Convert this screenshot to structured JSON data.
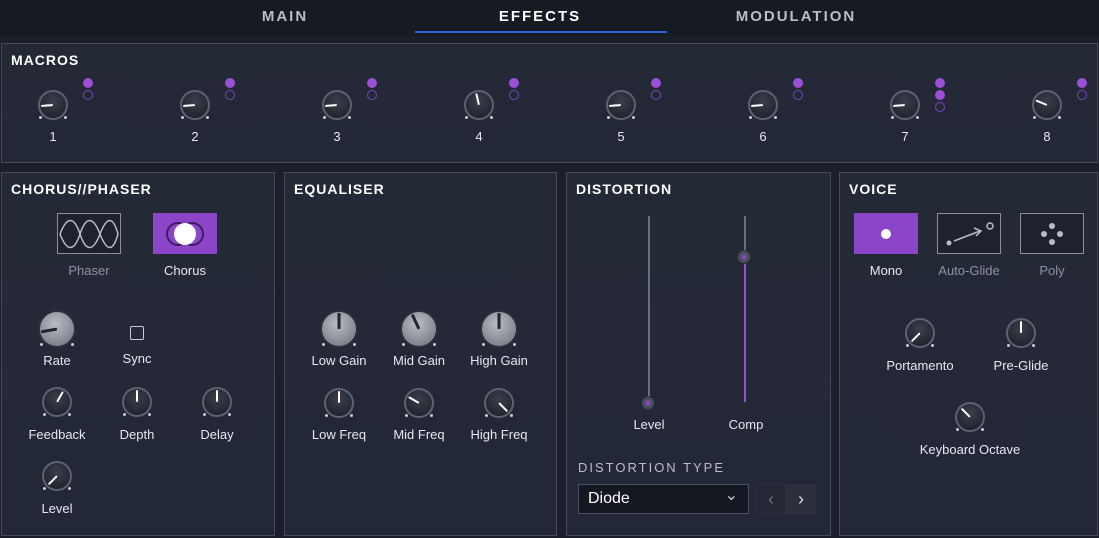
{
  "tabs": [
    {
      "label": "MAIN",
      "active": false
    },
    {
      "label": "EFFECTS",
      "active": true
    },
    {
      "label": "MODULATION",
      "active": false
    }
  ],
  "macros": {
    "title": "MACROS",
    "knobs": [
      {
        "label": "1",
        "value": 0.15
      },
      {
        "label": "2",
        "value": 0.15
      },
      {
        "label": "3",
        "value": 0.15
      },
      {
        "label": "4",
        "value": 0.45
      },
      {
        "label": "5",
        "value": 0.15
      },
      {
        "label": "6",
        "value": 0.15
      },
      {
        "label": "7",
        "value": 0.15
      },
      {
        "label": "8",
        "value": 0.25
      }
    ]
  },
  "chorus_phaser": {
    "title": "CHORUS//PHASER",
    "modes": [
      {
        "label": "Phaser",
        "icon": "sine-wave-icon",
        "active": false
      },
      {
        "label": "Chorus",
        "icon": "chorus-circles-icon",
        "active": true
      }
    ],
    "rate_label": "Rate",
    "sync_label": "Sync",
    "feedback_label": "Feedback",
    "depth_label": "Depth",
    "delay_label": "Delay",
    "level_label": "Level"
  },
  "equaliser": {
    "title": "EQUALISER",
    "low_gain": "Low Gain",
    "mid_gain": "Mid Gain",
    "high_gain": "High Gain",
    "low_freq": "Low Freq",
    "mid_freq": "Mid Freq",
    "high_freq": "High Freq"
  },
  "distortion": {
    "title": "DISTORTION",
    "level_label": "Level",
    "level_value": 0.0,
    "comp_label": "Comp",
    "comp_value": 0.8,
    "type_title": "DISTORTION TYPE",
    "type_value": "Diode",
    "prev_glyph": "‹",
    "next_glyph": "›",
    "dropdown_chevron": "⌄"
  },
  "voice": {
    "title": "VOICE",
    "modes": [
      {
        "label": "Mono",
        "icon": "dot-icon",
        "active": true
      },
      {
        "label": "Auto-Glide",
        "icon": "glide-arrow-icon",
        "active": false
      },
      {
        "label": "Poly",
        "icon": "poly-dots-icon",
        "active": false
      }
    ],
    "portamento_label": "Portamento",
    "preglide_label": "Pre-Glide",
    "keyboard_octave_label": "Keyboard Octave"
  },
  "colors": {
    "accent": "#9b4fd6",
    "tab_underline": "#2f62d8",
    "background": "#1b1f29"
  }
}
